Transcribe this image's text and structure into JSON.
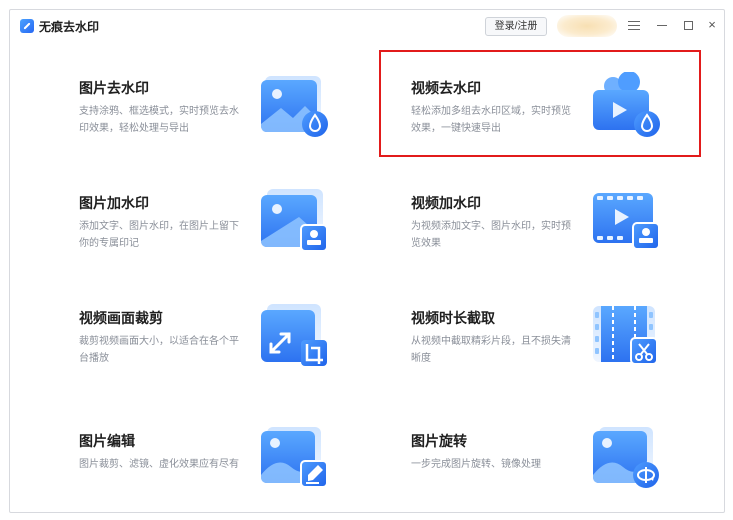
{
  "app": {
    "title": "无痕去水印",
    "login_label": "登录/注册"
  },
  "window_controls": {
    "menu": "menu-icon",
    "minimize": "minimize-icon",
    "maximize": "maximize-icon",
    "close": "close-icon"
  },
  "cards": [
    {
      "title": "图片去水印",
      "desc": "支持涂鸦、框选模式，实时预览去水印效果，轻松处理与导出",
      "icon": "image-remove-watermark-icon"
    },
    {
      "title": "视频去水印",
      "desc": "轻松添加多组去水印区域，实时预览效果，一键快速导出",
      "icon": "video-remove-watermark-icon"
    },
    {
      "title": "图片加水印",
      "desc": "添加文字、图片水印，在图片上留下你的专属印记",
      "icon": "image-add-watermark-icon"
    },
    {
      "title": "视频加水印",
      "desc": "为视频添加文字、图片水印，实时预览效果",
      "icon": "video-add-watermark-icon"
    },
    {
      "title": "视频画面裁剪",
      "desc": "裁剪视频画面大小，以适合在各个平台播放",
      "icon": "video-crop-icon"
    },
    {
      "title": "视频时长截取",
      "desc": "从视频中截取精彩片段，且不损失清晰度",
      "icon": "video-trim-icon"
    },
    {
      "title": "图片编辑",
      "desc": "图片裁剪、滤镜、虚化效果应有尽有",
      "icon": "image-edit-icon"
    },
    {
      "title": "图片旋转",
      "desc": "一步完成图片旋转、镜像处理",
      "icon": "image-rotate-icon"
    }
  ],
  "colors": {
    "accent": "#2f7bf5",
    "accent_light": "#6fb0ff",
    "highlight": "#e21b1b",
    "desc_text": "#8a8f99"
  }
}
